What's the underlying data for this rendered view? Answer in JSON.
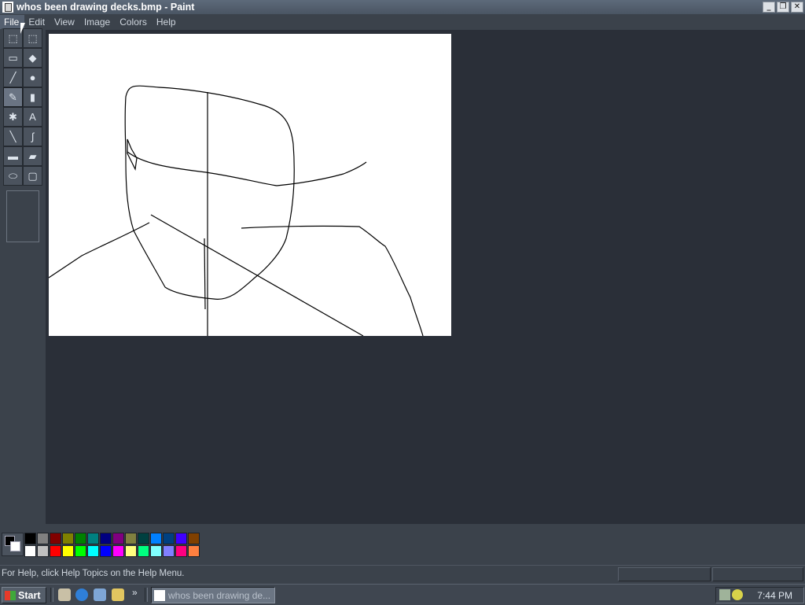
{
  "window": {
    "title": "whos been drawing decks.bmp - Paint",
    "controls": [
      "minimize",
      "restore",
      "close"
    ]
  },
  "menu": {
    "items": [
      "File",
      "Edit",
      "View",
      "Image",
      "Colors",
      "Help"
    ],
    "active": "File"
  },
  "toolbox": {
    "tools": [
      {
        "icon": "free-form-select-icon",
        "glyph": "⬚"
      },
      {
        "icon": "rect-select-icon",
        "glyph": "⬚"
      },
      {
        "icon": "eraser-icon",
        "glyph": "▭"
      },
      {
        "icon": "fill-bucket-icon",
        "glyph": "◆"
      },
      {
        "icon": "color-picker-icon",
        "glyph": "╱"
      },
      {
        "icon": "magnifier-icon",
        "glyph": "●"
      },
      {
        "icon": "pencil-icon",
        "glyph": "✎"
      },
      {
        "icon": "brush-icon",
        "glyph": "▮"
      },
      {
        "icon": "airbrush-icon",
        "glyph": "✱"
      },
      {
        "icon": "text-icon",
        "glyph": "A"
      },
      {
        "icon": "line-icon",
        "glyph": "╲"
      },
      {
        "icon": "curve-icon",
        "glyph": "∫"
      },
      {
        "icon": "rectangle-icon",
        "glyph": "▬"
      },
      {
        "icon": "polygon-icon",
        "glyph": "▰"
      },
      {
        "icon": "ellipse-icon",
        "glyph": "⬭"
      },
      {
        "icon": "rounded-rect-icon",
        "glyph": "▢"
      }
    ],
    "selected": "pencil-icon"
  },
  "colors": {
    "foreground": "#000000",
    "background": "#ffffff",
    "palette": [
      "#000000",
      "#808080",
      "#800000",
      "#808000",
      "#008000",
      "#008080",
      "#000080",
      "#800080",
      "#808040",
      "#004040",
      "#0080ff",
      "#004080",
      "#4000ff",
      "#804000",
      "#ffffff",
      "#c0c0c0",
      "#ff0000",
      "#ffff00",
      "#00ff00",
      "#00ffff",
      "#0000ff",
      "#ff00ff",
      "#ffff80",
      "#00ff80",
      "#80ffff",
      "#8080ff",
      "#ff0080",
      "#ff8040"
    ]
  },
  "status": {
    "help_text": "For Help, click Help Topics on the Help Menu."
  },
  "taskbar": {
    "start_label": "Start",
    "more_glyph": "»",
    "task_button": "whos been drawing de...",
    "clock": "7:44 PM"
  }
}
